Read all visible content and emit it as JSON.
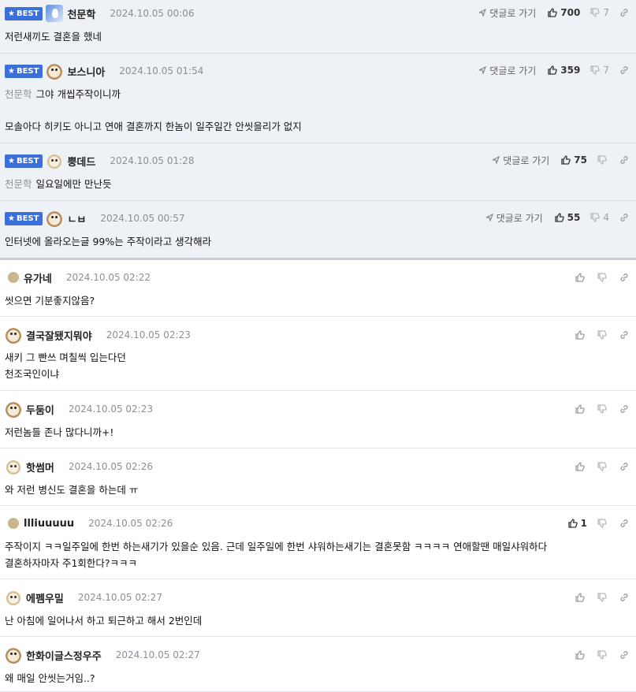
{
  "best_label": "BEST",
  "goto_label": "댓글로 가기",
  "comments": [
    {
      "best": true,
      "avatar": "blue",
      "nick": "천문학",
      "date": "2024.10.05 00:06",
      "ref": "",
      "lines": [
        "저런새끼도 결혼을 했네"
      ],
      "up": "700",
      "down": "7"
    },
    {
      "best": true,
      "avatar": "dog",
      "nick": "보스니아",
      "date": "2024.10.05 01:54",
      "ref": "천문학",
      "lines": [
        "그야 개씹주작이니까",
        "",
        "모솔아다 히키도 아니고 연애 결혼까지 한놈이 일주일간 안씻을리가 없지"
      ],
      "up": "359",
      "down": "7"
    },
    {
      "best": true,
      "avatar": "puppy",
      "nick": "뿡데드",
      "date": "2024.10.05 01:28",
      "ref": "천문학",
      "lines": [
        "일요일에만 만난듯"
      ],
      "up": "75",
      "down": ""
    },
    {
      "best": true,
      "avatar": "dog",
      "nick": "ㄴㅂ",
      "date": "2024.10.05 00:57",
      "ref": "",
      "lines": [
        "인터넷에 올라오는글 99%는 주작이라고 생각해라"
      ],
      "up": "55",
      "down": "4"
    },
    {
      "best": false,
      "avatar": "dot",
      "nick": "유가네",
      "date": "2024.10.05 02:22",
      "ref": "",
      "lines": [
        "씻으면 기분좋지않음?"
      ],
      "up": "",
      "down": ""
    },
    {
      "best": false,
      "avatar": "dog",
      "nick": "결국잘됐지뭐야",
      "date": "2024.10.05 02:23",
      "ref": "",
      "lines": [
        "새키 그 빤쓰 며칠씩 입는다던",
        "천조국인이냐"
      ],
      "up": "",
      "down": ""
    },
    {
      "best": false,
      "avatar": "dog",
      "nick": "두둠이",
      "date": "2024.10.05 02:23",
      "ref": "",
      "lines": [
        "저런놈들 존나 많다니까+!"
      ],
      "up": "",
      "down": ""
    },
    {
      "best": false,
      "avatar": "puppy",
      "nick": "핫썸머",
      "date": "2024.10.05 02:26",
      "ref": "",
      "lines": [
        "와 저런 병신도 결혼을 하는데 ㅠ"
      ],
      "up": "",
      "down": ""
    },
    {
      "best": false,
      "avatar": "dot",
      "nick": "llliuuuuu",
      "date": "2024.10.05 02:26",
      "ref": "",
      "lines": [
        "주작이지 ㅋㅋ일주일에 한번 하는새기가 있을순 있음. 근데 일주일에 한번 샤워하는새기는 결혼못함 ㅋㅋㅋㅋ 연애할땐 매일샤워하다",
        "결혼하자마자 주1회한다?ㅋㅋㅋ"
      ],
      "up": "1",
      "down": ""
    },
    {
      "best": false,
      "avatar": "puppy",
      "nick": "에펨우밀",
      "date": "2024.10.05 02:27",
      "ref": "",
      "lines": [
        "난 아침에 일어나서 하고 퇴근하고 해서 2번인데"
      ],
      "up": "",
      "down": ""
    },
    {
      "best": false,
      "avatar": "dog",
      "nick": "한화이글스정우주",
      "date": "2024.10.05 02:27",
      "ref": "",
      "lines": [
        "왜 매일 안씻는거임..?"
      ],
      "up": "",
      "down": ""
    }
  ]
}
